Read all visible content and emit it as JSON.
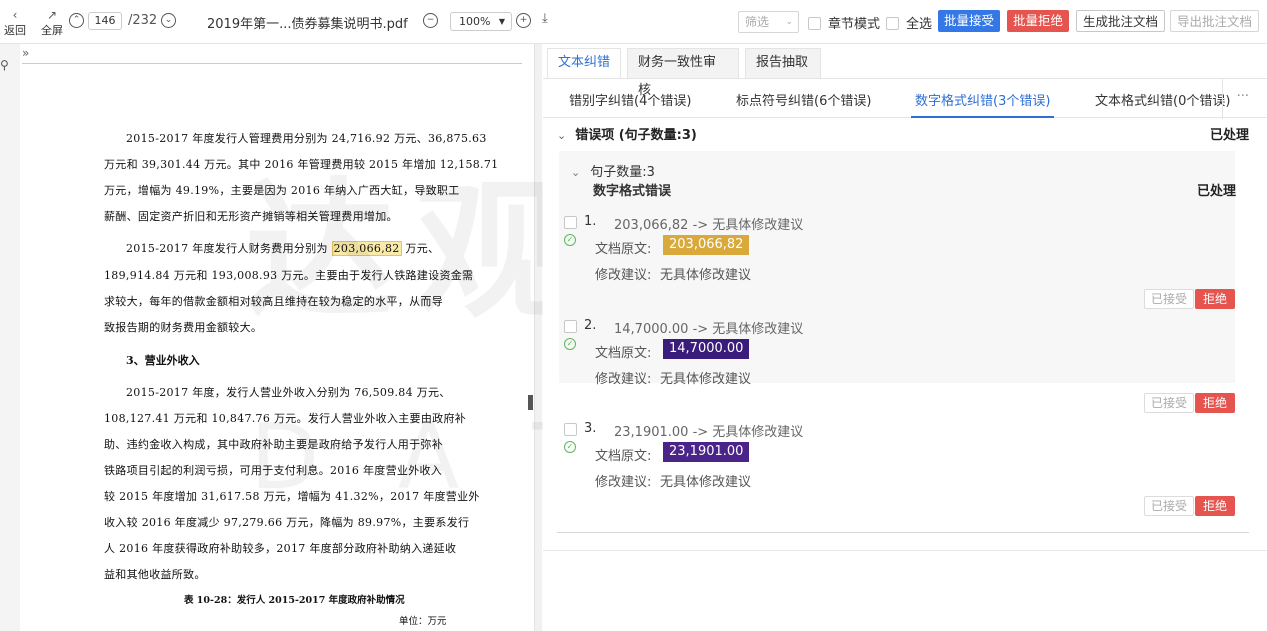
{
  "toolbar": {
    "back_label": "返回",
    "fullscreen_label": "全屏",
    "current_page": "146",
    "total_pages": "/232",
    "file_name": "2019年第一...债券募集说明书.pdf",
    "zoom": "100%",
    "filter_placeholder": "筛选",
    "chapter_mode_label": "章节模式",
    "select_all_label": "全选",
    "batch_accept_label": "批量接受",
    "batch_reject_label": "批量拒绝",
    "generate_doc_label": "生成批注文档",
    "export_doc_label": "导出批注文档",
    "colors": {
      "accept": "#3478e8",
      "reject": "#e5544f"
    }
  },
  "document": {
    "lines": [
      "2015-2017 年度发行人管理费用分别为 24,716.92 万元、36,875.63",
      "万元和 39,301.44 万元。其中 2016 年管理费用较 2015 年增加 12,158.71",
      "万元，增幅为 49.19%，主要是因为 2016 年纳入广西大缸，导致职工",
      "薪酬、固定资产折旧和无形资产摊销等相关管理费用增加。",
      "2015-2017 年度发行人财务费用分别为",
      "203,066,82",
      "万元、",
      "189,914.84 万元和 193,008.93 万元。主要由于发行人铁路建设资金需",
      "求较大，每年的借款金额相对较高且维持在较为稳定的水平，从而导",
      "致报告期的财务费用金额较大。",
      "3、营业外收入",
      "2015-2017 年度，发行人营业外收入分别为 76,509.84 万元、",
      "108,127.41 万元和 10,847.76 万元。发行人营业外收入主要由政府补",
      "助、违约金收入构成，其中政府补助主要是政府给予发行人用于弥补",
      "铁路项目引起的利润亏损，可用于支付利息。2016 年度营业外收入",
      "较 2015 年度增加 31,617.58 万元，增幅为 41.32%，2017 年度营业外",
      "收入较 2016 年度减少 97,279.66 万元，降幅为 89.97%，主要系发行",
      "人 2016 年度获得政府补助较多，2017 年度部分政府补助纳入递延收",
      "益和其他收益所致。",
      "表 10-28：发行人 2015-2017 年度政府补助情况",
      "单位：万元"
    ]
  },
  "panel": {
    "tabs": [
      "文本纠错",
      "财务一致性审核",
      "报告抽取"
    ],
    "subtabs": [
      "错别字纠错(4个错误)",
      "标点符号纠错(6个错误)",
      "数字格式纠错(3个错误)",
      "文本格式纠错(0个错误)"
    ],
    "more_label": "···",
    "section_title": "错误项 (句子数量:3)",
    "section_status": "已处理",
    "group_title": "句子数量:3",
    "group_subtitle": "数字格式错误",
    "group_status": "已处理",
    "orig_label": "文档原文:",
    "sugg_label": "修改建议:",
    "accepted_label": "已接受",
    "reject_label": "拒绝",
    "items": [
      {
        "num": "1.",
        "title": "203,066,82 -> 无具体修改建议",
        "orig": "203,066,82",
        "suggestion": "无具体修改建议",
        "color": "#d9a93b"
      },
      {
        "num": "2.",
        "title": "14,7000.00 -> 无具体修改建议",
        "orig": "14,7000.00",
        "suggestion": "无具体修改建议",
        "color": "#3a1d7a"
      },
      {
        "num": "3.",
        "title": "23,1901.00 -> 无具体修改建议",
        "orig": "23,1901.00",
        "suggestion": "无具体修改建议",
        "color": "#4b2489"
      }
    ]
  },
  "watermark": {
    "cn": "达观数据",
    "en": "DATAGRAND"
  }
}
